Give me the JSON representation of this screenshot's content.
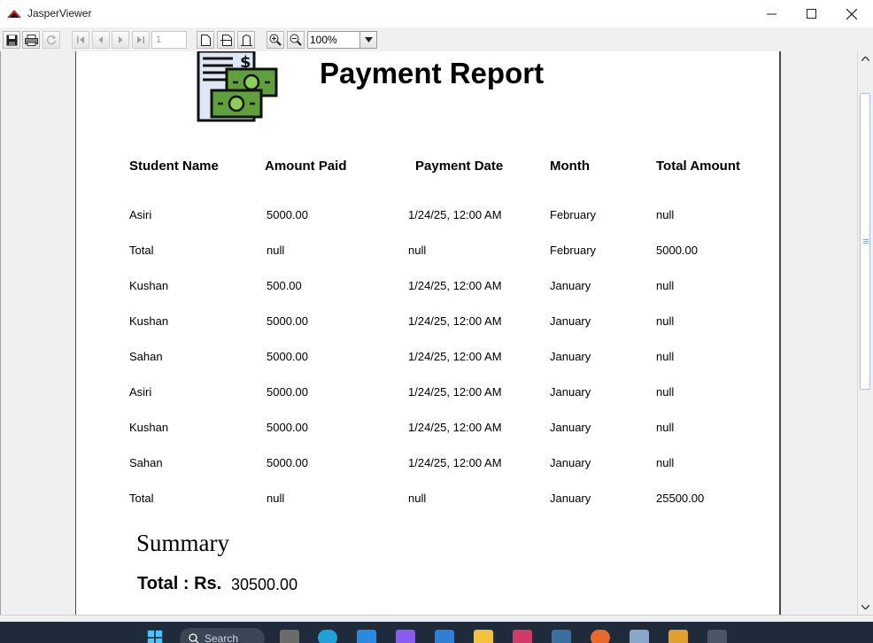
{
  "window": {
    "title": "JasperViewer"
  },
  "toolbar": {
    "page_number": "1",
    "zoom": "100%"
  },
  "report": {
    "title": "Payment Report",
    "columns": [
      "Student Name",
      "Amount Paid",
      "Payment Date",
      "Month",
      "Total Amount"
    ],
    "rows": [
      [
        "Asiri",
        "5000.00",
        "1/24/25, 12:00 AM",
        "February",
        "null"
      ],
      [
        "Total",
        "null",
        "null",
        "February",
        "5000.00"
      ],
      [
        "Kushan",
        "500.00",
        "1/24/25, 12:00 AM",
        "January",
        "null"
      ],
      [
        "Kushan",
        "5000.00",
        "1/24/25, 12:00 AM",
        "January",
        "null"
      ],
      [
        "Sahan",
        "5000.00",
        "1/24/25, 12:00 AM",
        "January",
        "null"
      ],
      [
        "Asiri",
        "5000.00",
        "1/24/25, 12:00 AM",
        "January",
        "null"
      ],
      [
        "Kushan",
        "5000.00",
        "1/24/25, 12:00 AM",
        "January",
        "null"
      ],
      [
        "Sahan",
        "5000.00",
        "1/24/25, 12:00 AM",
        "January",
        "null"
      ],
      [
        "Total",
        "null",
        "null",
        "January",
        "25500.00"
      ]
    ],
    "summary": {
      "title": "Summary",
      "total_label": "Total : Rs.",
      "total_value": "30500.00"
    }
  },
  "taskbar": {
    "search_placeholder": "Search"
  },
  "colors": {
    "logo_green": "#5fa03c",
    "logo_paper": "#dfe6f5",
    "app_icon_red": "#c0282d"
  }
}
